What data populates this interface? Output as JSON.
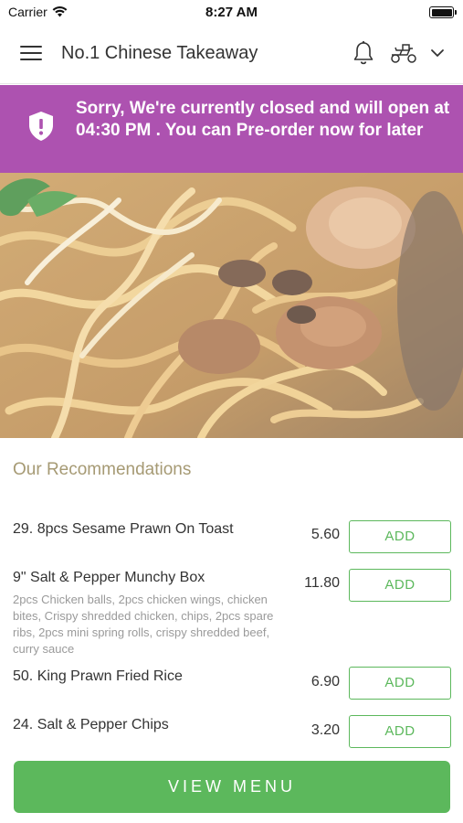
{
  "status_bar": {
    "carrier": "Carrier",
    "time": "8:27 AM"
  },
  "header": {
    "title": "No.1 Chinese Takeaway",
    "icons": [
      "menu-icon",
      "bell-icon",
      "scooter-icon",
      "chevron-down-icon"
    ]
  },
  "banner": {
    "message": "Sorry, We're currently closed and will open at 04:30 PM . You can Pre-order now for later",
    "icon": "shield-icon",
    "color": "#ad52b0"
  },
  "recommendations": {
    "title": "Our Recommendations",
    "items": [
      {
        "name": "29. 8pcs Sesame Prawn On Toast",
        "description": "",
        "price": "5.60",
        "add_label": "ADD"
      },
      {
        "name": "9\" Salt & Pepper Munchy Box",
        "description": "2pcs Chicken balls, 2pcs chicken wings, chicken bites, Crispy shredded chicken, chips, 2pcs spare ribs, 2pcs mini spring rolls, crispy shredded beef, curry sauce",
        "price": "11.80",
        "add_label": "ADD"
      },
      {
        "name": "50. King Prawn Fried Rice",
        "description": "",
        "price": "6.90",
        "add_label": "ADD"
      },
      {
        "name": "24. Salt & Pepper Chips",
        "description": "",
        "price": "3.20",
        "add_label": "ADD"
      }
    ]
  },
  "view_menu_label": "VIEW MENU",
  "colors": {
    "accent_green": "#5cb85c",
    "banner_purple": "#ad52b0",
    "section_title": "#a69a74"
  }
}
